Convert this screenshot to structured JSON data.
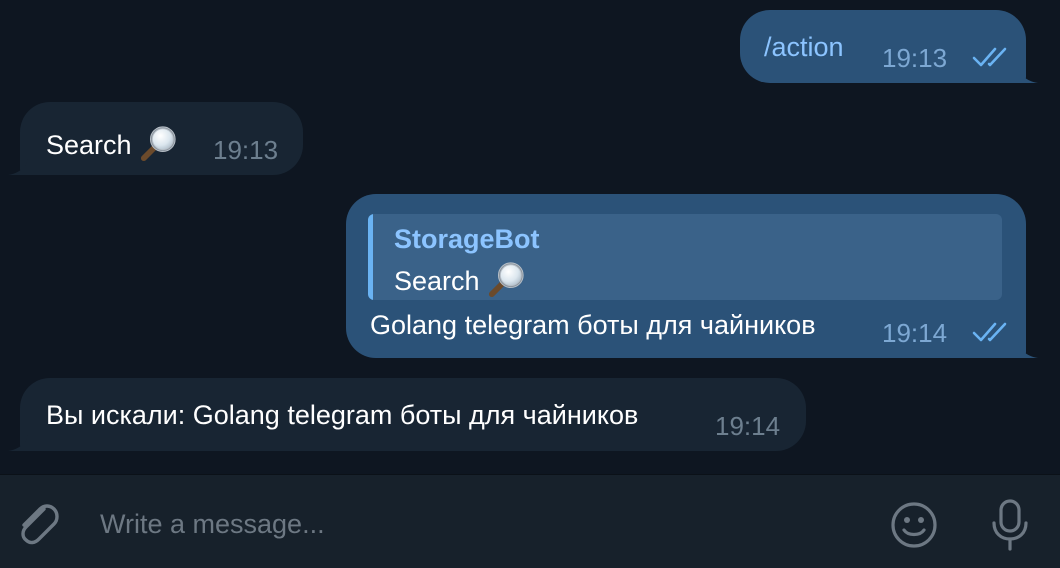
{
  "messages": [
    {
      "direction": "outgoing",
      "text": "/action",
      "time": "19:13",
      "status_icon": "double-check-icon"
    },
    {
      "direction": "incoming",
      "text": "Search",
      "emoji": "magnifying-glass-icon",
      "time": "19:13"
    },
    {
      "direction": "outgoing",
      "reply": {
        "author": "StorageBot",
        "text": "Search",
        "emoji": "magnifying-glass-icon"
      },
      "text": "Golang telegram боты для чайников",
      "time": "19:14",
      "status_icon": "double-check-icon"
    },
    {
      "direction": "incoming",
      "text": "Вы искали: Golang telegram боты для чайников",
      "time": "19:14"
    }
  ],
  "composer": {
    "placeholder": "Write a message...",
    "value": "",
    "attach_icon": "paperclip-icon",
    "emoji_icon": "smiley-icon",
    "mic_icon": "microphone-icon"
  },
  "colors": {
    "background": "#0e1621",
    "outgoing_bubble": "#2b5278",
    "incoming_bubble": "#182533",
    "reply_background": "#3a6289",
    "accent": "#6ab3f3",
    "composer_background": "#17212b"
  }
}
